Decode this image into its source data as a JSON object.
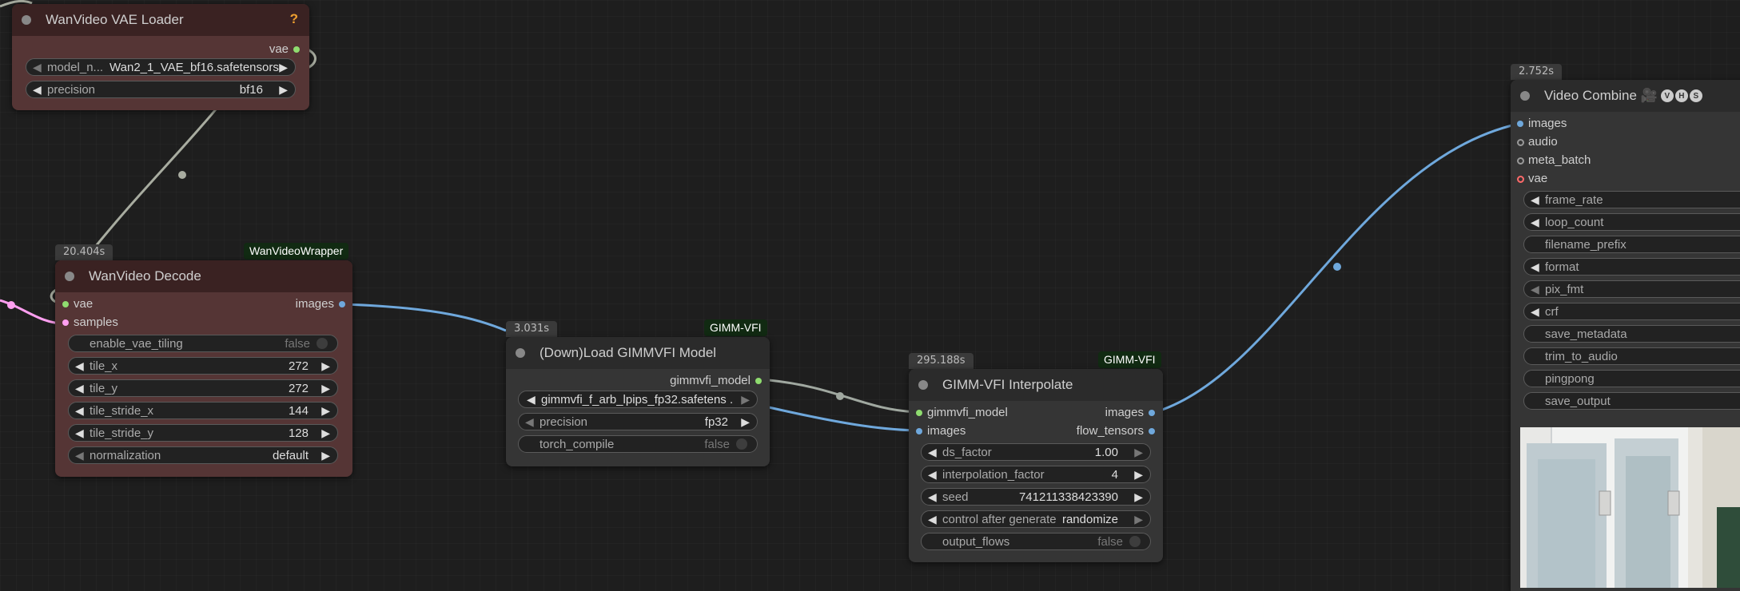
{
  "colors": {
    "vae_link": "#b8bcb0",
    "images_link": "#6fa8dc",
    "latent_link": "#ff9ff0",
    "model_link": "#a0a8a0",
    "dot_green": "#8fdc6f",
    "dot_blue": "#6fa8dc",
    "dot_pink": "#ff9ff0",
    "dot_red": "#ff6a6a"
  },
  "vae_loader": {
    "title": "WanVideo VAE Loader",
    "help": "?",
    "out_vae": "vae",
    "model_label": "model_n...",
    "model_value": "Wan2_1_VAE_bf16.safetensors",
    "precision_label": "precision",
    "precision_value": "bf16"
  },
  "decode": {
    "timing": "20.404s",
    "badge": "WanVideoWrapper",
    "title": "WanVideo Decode",
    "in_vae": "vae",
    "in_samples": "samples",
    "out_images": "images",
    "widgets": [
      {
        "label": "enable_vae_tiling",
        "value": "false"
      },
      {
        "label": "tile_x",
        "value": "272"
      },
      {
        "label": "tile_y",
        "value": "272"
      },
      {
        "label": "tile_stride_x",
        "value": "144"
      },
      {
        "label": "tile_stride_y",
        "value": "128"
      },
      {
        "label": "normalization",
        "value": "default"
      }
    ]
  },
  "gimm_loader": {
    "timing": "3.031s",
    "badge": "GIMM-VFI",
    "title": "(Down)Load GIMMVFI Model",
    "out_model": "gimmvfi_model",
    "model_value": "gimmvfi_f_arb_lpips_fp32.safetens ...",
    "precision_label": "precision",
    "precision_value": "fp32",
    "compile_label": "torch_compile",
    "compile_value": "false"
  },
  "interp": {
    "timing": "295.188s",
    "badge": "GIMM-VFI",
    "title": "GIMM-VFI Interpolate",
    "in_model": "gimmvfi_model",
    "in_images": "images",
    "out_images": "images",
    "out_flow": "flow_tensors",
    "widgets": [
      {
        "label": "ds_factor",
        "value": "1.00"
      },
      {
        "label": "interpolation_factor",
        "value": "4"
      },
      {
        "label": "seed",
        "value": "741211338423390"
      },
      {
        "label": "control after generate",
        "value": "randomize"
      },
      {
        "label": "output_flows",
        "value": "false"
      }
    ]
  },
  "combine": {
    "timing": "2.752s",
    "title": "Video Combine 🎥",
    "vhs": [
      "V",
      "H",
      "S"
    ],
    "inputs": [
      "images",
      "audio",
      "meta_batch",
      "vae"
    ],
    "widgets": [
      "frame_rate",
      "loop_count",
      "filename_prefix",
      "format",
      "pix_fmt",
      "crf",
      "save_metadata",
      "trim_to_audio",
      "pingpong",
      "save_output"
    ]
  }
}
